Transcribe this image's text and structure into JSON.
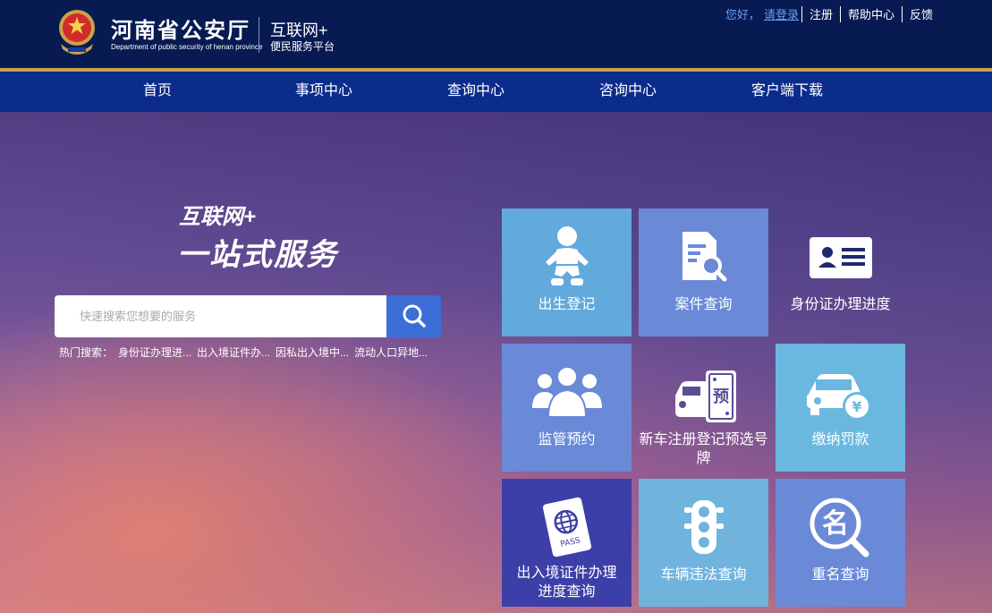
{
  "header": {
    "org_name": "河南省公安厅",
    "org_name_en": "Department of public security of henan province",
    "platform_title": "互联网+",
    "platform_subtitle": "便民服务平台",
    "greeting": "您好，",
    "login": "请登录",
    "register": "注册",
    "help": "帮助中心",
    "feedback": "反馈"
  },
  "nav": {
    "items": [
      "首页",
      "事项中心",
      "查询中心",
      "咨询中心",
      "客户端下载"
    ]
  },
  "hero": {
    "slogan_line1": "互联网+",
    "slogan_line2": "一站式服务",
    "search_placeholder": "快速搜索您想要的服务",
    "hot_label": "热门搜索：",
    "hot_items": [
      "身份证办理进...",
      "出入境证件办...",
      "因私出入境中...",
      "流动人口异地..."
    ]
  },
  "tiles": [
    {
      "label": "出生登记",
      "icon": "baby-icon",
      "color": "#62a9dc"
    },
    {
      "label": "案件查询",
      "icon": "document-search-icon",
      "color": "#6a8ad8"
    },
    {
      "label": "身份证办理进度",
      "icon": "id-card-icon",
      "color": "transparent"
    },
    {
      "label": "监管预约",
      "icon": "people-group-icon",
      "color": "#6a8ad8"
    },
    {
      "label": "新车注册登记预选号牌",
      "icon": "car-plate-icon",
      "color": "transparent"
    },
    {
      "label": "缴纳罚款",
      "icon": "car-yuan-icon",
      "color": "#6ab8e0"
    },
    {
      "label": "出入境证件办理进度查询",
      "icon": "passport-icon",
      "color": "#3d3fa8"
    },
    {
      "label": "车辆违法查询",
      "icon": "traffic-light-icon",
      "color": "#70b4de"
    },
    {
      "label": "重名查询",
      "icon": "name-search-icon",
      "color": "#6a8ad8"
    }
  ],
  "colors": {
    "header_bg": "#071a52",
    "nav_bg": "#0c2c8c",
    "accent_gold": "#c9a347",
    "search_btn": "#3c6ed8",
    "link": "#6a9ff5"
  }
}
